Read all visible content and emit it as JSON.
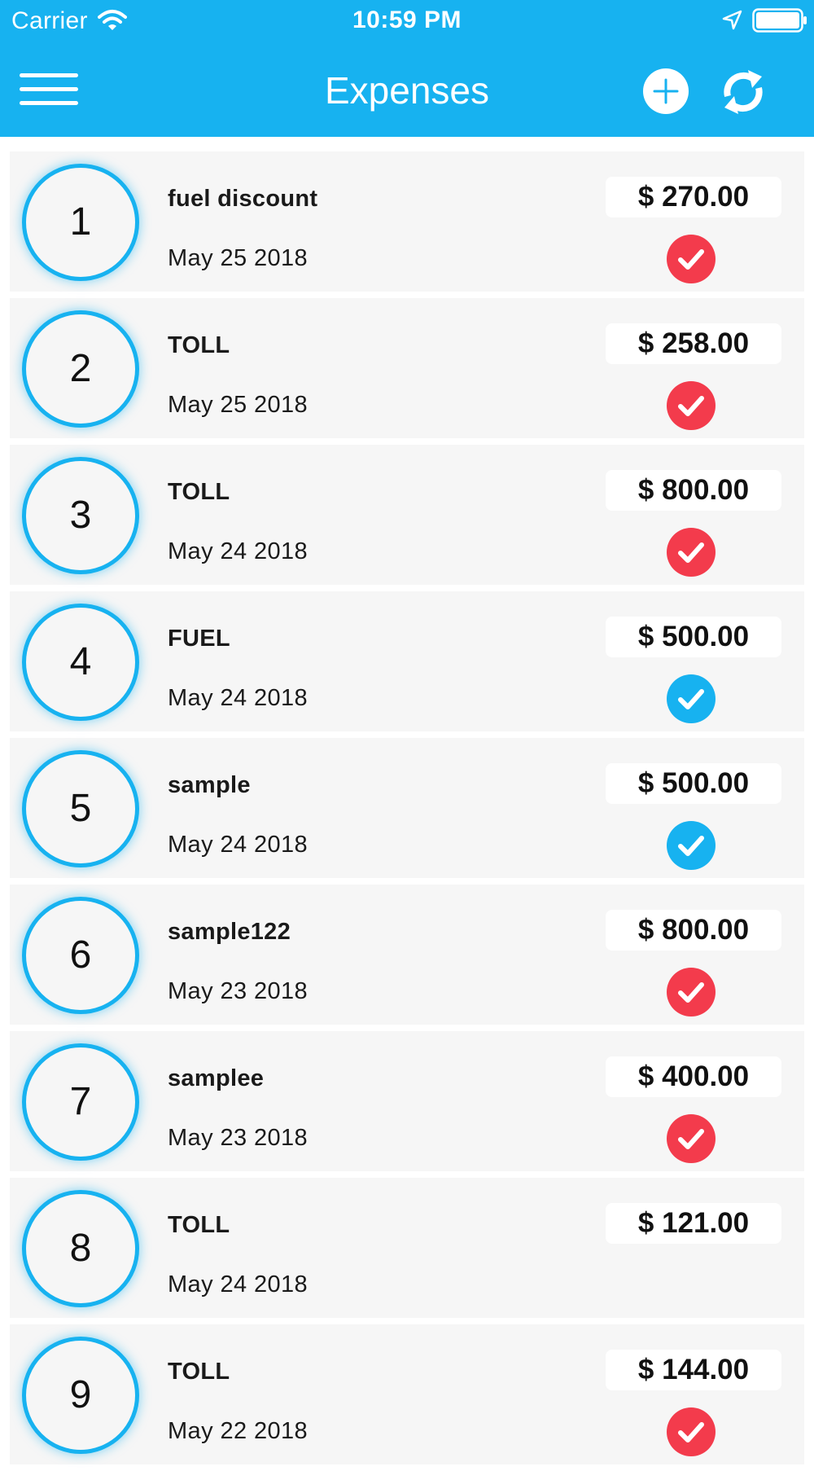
{
  "status_bar": {
    "carrier": "Carrier",
    "time": "10:59 PM"
  },
  "header": {
    "title": "Expenses",
    "menu_icon": "hamburger-menu-icon",
    "add_icon": "plus-circle-icon",
    "refresh_icon": "refresh-icon"
  },
  "colors": {
    "accent": "#17b2f0",
    "status_pending": "#f33b4c",
    "status_approved": "#17b2f0",
    "row_background": "#f6f6f6"
  },
  "expenses": [
    {
      "index": "1",
      "title": "fuel discount",
      "date": "May 25 2018",
      "amount": "$ 270.00",
      "status": "red"
    },
    {
      "index": "2",
      "title": "TOLL",
      "date": "May 25 2018",
      "amount": "$ 258.00",
      "status": "red"
    },
    {
      "index": "3",
      "title": "TOLL",
      "date": "May 24 2018",
      "amount": "$ 800.00",
      "status": "red"
    },
    {
      "index": "4",
      "title": "FUEL",
      "date": "May 24 2018",
      "amount": "$ 500.00",
      "status": "blue"
    },
    {
      "index": "5",
      "title": "sample",
      "date": "May 24 2018",
      "amount": "$ 500.00",
      "status": "blue"
    },
    {
      "index": "6",
      "title": "sample122",
      "date": "May 23 2018",
      "amount": "$ 800.00",
      "status": "red"
    },
    {
      "index": "7",
      "title": "samplee",
      "date": "May 23 2018",
      "amount": "$ 400.00",
      "status": "red"
    },
    {
      "index": "8",
      "title": "TOLL",
      "date": "May 24 2018",
      "amount": "$ 121.00",
      "status": "none"
    },
    {
      "index": "9",
      "title": "TOLL",
      "date": "May 22 2018",
      "amount": "$ 144.00",
      "status": "red"
    }
  ]
}
